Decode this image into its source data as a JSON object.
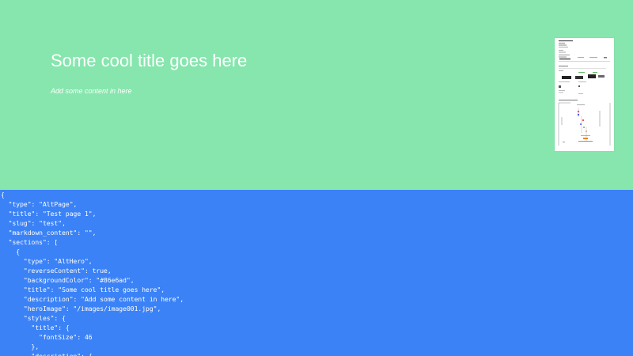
{
  "hero": {
    "title": "Some cool title goes here",
    "description": "Add some content in here",
    "background_color": "#86e6ad",
    "image_icon": "document-thumbnail-icon"
  },
  "json_panel": {
    "background_color": "#3b82f6",
    "text_color": "#ffffff",
    "code": "{\n  \"type\": \"AltPage\",\n  \"title\": \"Test page 1\",\n  \"slug\": \"test\",\n  \"markdown_content\": \"\",\n  \"sections\": [\n    {\n      \"type\": \"AltHero\",\n      \"reverseContent\": true,\n      \"backgroundColor\": \"#86e6ad\",\n      \"title\": \"Some cool title goes here\",\n      \"description\": \"Add some content in here\",\n      \"heroImage\": \"/images/image001.jpg\",\n      \"styles\": {\n        \"title\": {\n          \"fontSize\": 46\n        },\n        \"description\": {"
  }
}
